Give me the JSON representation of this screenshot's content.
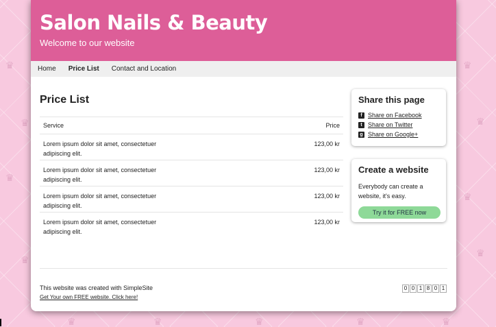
{
  "header": {
    "title": "Salon Nails & Beauty",
    "subtitle": "Welcome to our website"
  },
  "nav": [
    {
      "label": "Home"
    },
    {
      "label": "Price List"
    },
    {
      "label": "Contact and Location"
    }
  ],
  "main": {
    "title": "Price List",
    "table": {
      "headers": {
        "service": "Service",
        "price": "Price"
      },
      "rows": [
        {
          "line1": "Lorem ipsum dolor sit amet, consectetuer",
          "line2": "adipiscing elit.",
          "price": "123,00 kr"
        },
        {
          "line1": "Lorem ipsum dolor sit amet, consectetuer",
          "line2": "adipiscing elit.",
          "price": "123,00 kr"
        },
        {
          "line1": "Lorem ipsum dolor sit amet, consectetuer",
          "line2": "adipiscing elit.",
          "price": "123,00 kr"
        },
        {
          "line1": "Lorem ipsum dolor sit amet, consectetuer",
          "line2": "adipiscing elit.",
          "price": "123,00 kr"
        }
      ]
    }
  },
  "sidebar": {
    "share": {
      "title": "Share this page",
      "links": [
        {
          "label": "Share on Facebook",
          "icon": "facebook-icon"
        },
        {
          "label": "Share on Twitter",
          "icon": "twitter-icon"
        },
        {
          "label": "Share on Google+",
          "icon": "google-plus-icon"
        }
      ]
    },
    "create": {
      "title": "Create a website",
      "text_line1": "Everybody can create a",
      "text_line2": "website, it's easy.",
      "button": "Try it for FREE now"
    }
  },
  "footer": {
    "text": "This website was created with SimpleSite",
    "link": "Get Your own FREE website. Click here!",
    "counter": [
      "0",
      "0",
      "1",
      "8",
      "0",
      "1"
    ]
  },
  "colors": {
    "header_bg": "#dd5e98",
    "page_bg": "#f8c9df",
    "cta_bg": "#8ed998"
  }
}
